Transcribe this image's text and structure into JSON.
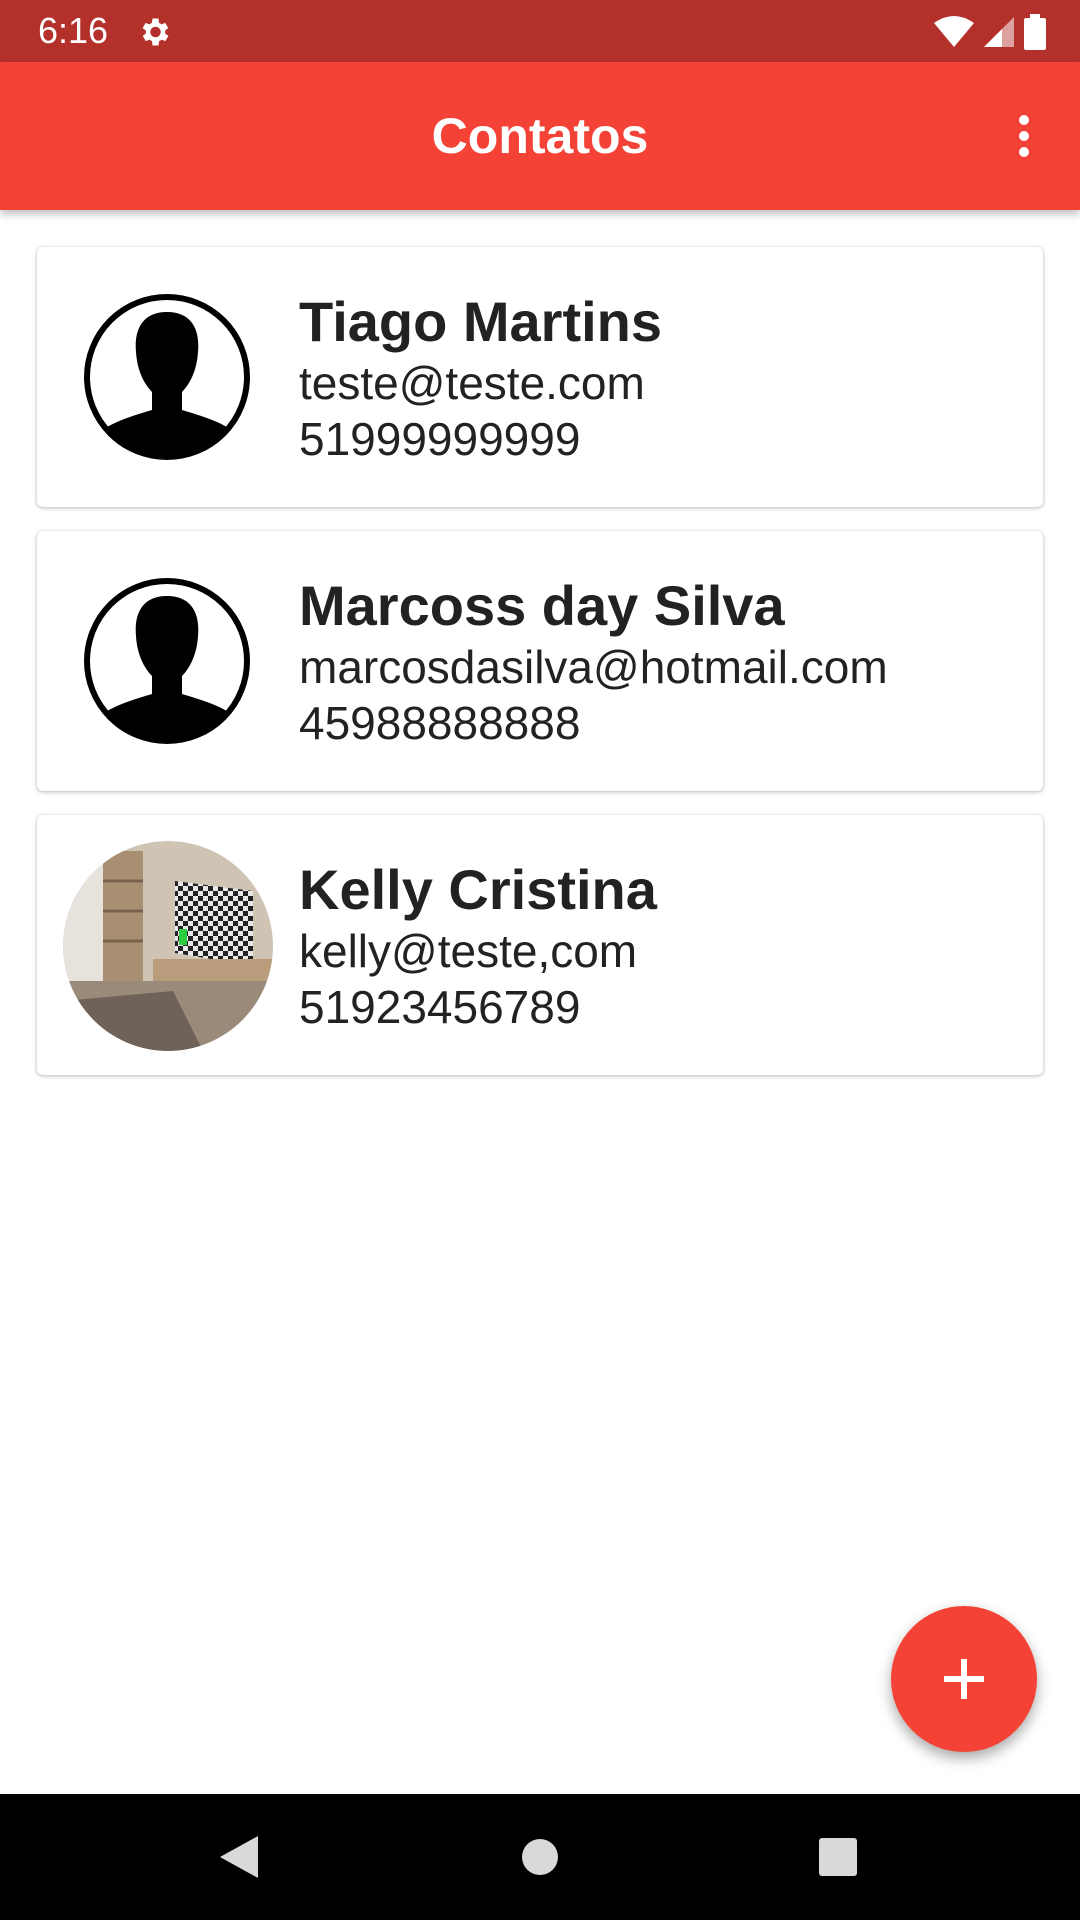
{
  "status_bar": {
    "time": "6:16",
    "icons": [
      "settings-gear-icon",
      "wifi-icon",
      "cell-signal-icon",
      "battery-icon"
    ],
    "background": "#b3302b"
  },
  "app_bar": {
    "title": "Contatos",
    "background": "#f44336",
    "menu_icon": "more-vert-icon"
  },
  "contacts": [
    {
      "name": "Tiago Martins",
      "email": "teste@teste.com",
      "phone": "51999999999",
      "avatar": "default-person-icon"
    },
    {
      "name": "Marcoss day Silva",
      "email": "marcosdasilva@hotmail.com",
      "phone": "45988888888",
      "avatar": "default-person-icon"
    },
    {
      "name": "Kelly Cristina",
      "email": "kelly@teste,com",
      "phone": "51923456789",
      "avatar": "photo-avatar"
    }
  ],
  "fab": {
    "icon": "plus-icon",
    "background": "#f44336"
  },
  "nav_bar": {
    "icons": [
      "back-icon",
      "home-icon",
      "recents-icon"
    ]
  }
}
